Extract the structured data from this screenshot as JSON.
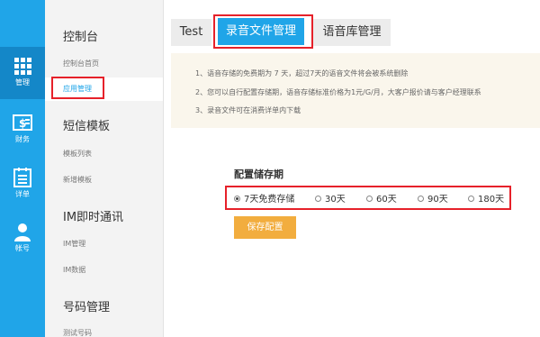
{
  "rail": [
    {
      "label": "管理",
      "icon": "grid-icon"
    },
    {
      "label": "财务",
      "icon": "dollar-icon"
    },
    {
      "label": "详单",
      "icon": "list-icon"
    },
    {
      "label": "帐号",
      "icon": "user-icon"
    }
  ],
  "subnav": {
    "groups": [
      {
        "title": "控制台",
        "items": [
          "控制台首页",
          "应用管理"
        ]
      },
      {
        "title": "短信模板",
        "items": [
          "模板列表",
          "新增模板"
        ]
      },
      {
        "title": "IM即时通讯",
        "items": [
          "IM管理",
          "IM数据"
        ]
      },
      {
        "title": "号码管理",
        "items": [
          "测试号码"
        ]
      }
    ]
  },
  "tabs": [
    "Test",
    "录音文件管理",
    "语音库管理"
  ],
  "notice": [
    "1、语音存储的免费期为 7 天，超过7天的语音文件将会被系统删除",
    "2、您可以自行配置存储期，语音存储标准价格为1元/G/月，大客户报价请与客户经理联系",
    "3、录音文件可在消费详单内下载"
  ],
  "config": {
    "title": "配置储存期",
    "options": [
      "7天免费存储",
      "30天",
      "60天",
      "90天",
      "180天"
    ],
    "selected": "7天免费存储",
    "save_label": "保存配置"
  },
  "colors": {
    "accent": "#20a5e8",
    "highlight": "#e6212a",
    "button": "#f2ad3e"
  }
}
